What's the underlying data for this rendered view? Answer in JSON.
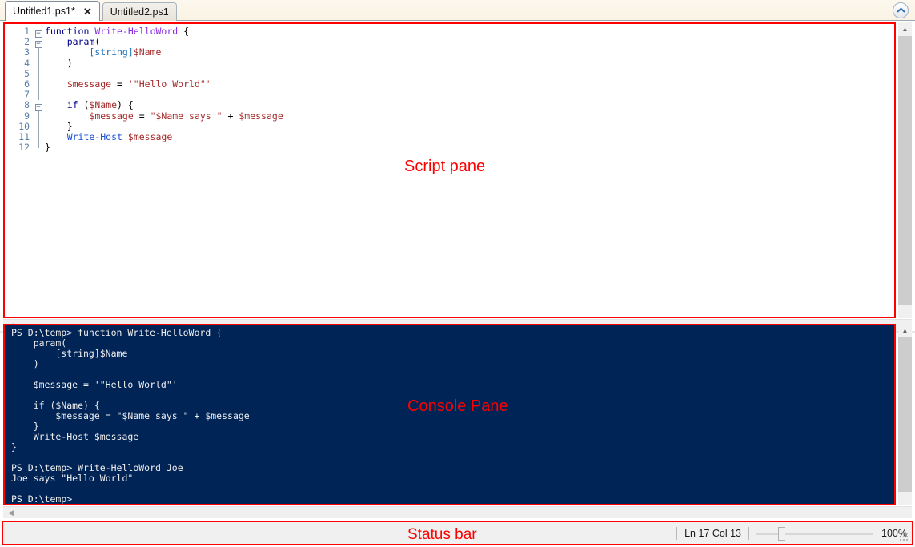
{
  "window": {
    "collapse_icon": "chevron-up-circle-icon"
  },
  "tabs": [
    {
      "label": "Untitled1.ps1*",
      "active": true,
      "close_glyph": "✕"
    },
    {
      "label": "Untitled2.ps1",
      "active": false
    }
  ],
  "script_pane": {
    "annotation": "Script pane",
    "line_numbers": [
      "1",
      "2",
      "3",
      "4",
      "5",
      "6",
      "7",
      "8",
      "9",
      "10",
      "11",
      "12"
    ],
    "lines": [
      {
        "n": "1",
        "fold": "box",
        "text": "function Write-HelloWord {"
      },
      {
        "n": "2",
        "fold": "box",
        "text": "    param("
      },
      {
        "n": "3",
        "fold": "line",
        "text": "        [string]$Name"
      },
      {
        "n": "4",
        "fold": "line",
        "text": "    )"
      },
      {
        "n": "5",
        "fold": "tick",
        "text": ""
      },
      {
        "n": "6",
        "fold": "line",
        "text": "    $message = '\"Hello World\"'"
      },
      {
        "n": "7",
        "fold": "line",
        "text": ""
      },
      {
        "n": "8",
        "fold": "box",
        "text": "    if ($Name) {"
      },
      {
        "n": "9",
        "fold": "line",
        "text": "        $message = \"$Name says \" + $message"
      },
      {
        "n": "10",
        "fold": "line",
        "text": "    }"
      },
      {
        "n": "11",
        "fold": "tick",
        "text": "    Write-Host $message"
      },
      {
        "n": "12",
        "fold": "end",
        "text": "}"
      }
    ]
  },
  "console_pane": {
    "annotation": "Console Pane",
    "text": "PS D:\\temp> function Write-HelloWord {\n    param(\n        [string]$Name\n    )\n\n    $message = '\"Hello World\"'\n\n    if ($Name) {\n        $message = \"$Name says \" + $message\n    }\n    Write-Host $message\n}\n\nPS D:\\temp> Write-HelloWord Joe\nJoe says \"Hello World\"\n\nPS D:\\temp>"
  },
  "status_bar": {
    "annotation": "Status bar",
    "line_col": "Ln 17  Col 13",
    "zoom_percent": "100%",
    "zoom_value": 100
  },
  "colors": {
    "annotation_red": "#ff0000",
    "console_bg": "#012456",
    "keyword": "#00008b",
    "function_name": "#8a2be2",
    "type": "#1f6fb4",
    "variable": "#a52a2a",
    "command": "#1a4fd6"
  }
}
